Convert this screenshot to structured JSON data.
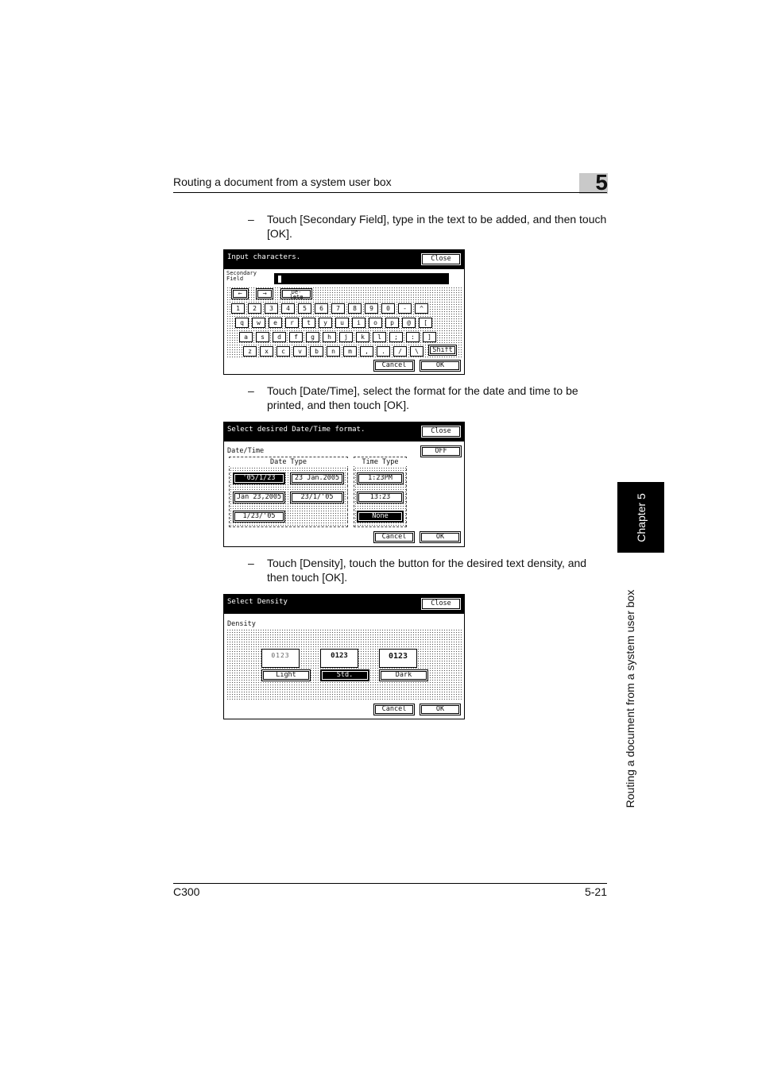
{
  "header": {
    "title": "Routing a document from a system user box",
    "chapter_number": "5"
  },
  "steps": [
    "Touch [Secondary Field], type in the text to be added, and then touch [OK].",
    "Touch [Date/Time], select the format for the date and time to be printed, and then touch [OK].",
    "Touch [Density], touch the button for the desired text density, and then touch [OK]."
  ],
  "dash": "–",
  "screen1": {
    "title": "Input characters.",
    "close": "Close",
    "field_label_1": "Secondary",
    "field_label_2": "Field",
    "left_arrow": "←",
    "right_arrow": "→",
    "delete_1": "De-",
    "delete_2": "lete",
    "row1": [
      "1",
      "2",
      "3",
      "4",
      "5",
      "6",
      "7",
      "8",
      "9",
      "0",
      "-",
      "^"
    ],
    "row2": [
      "q",
      "w",
      "e",
      "r",
      "t",
      "y",
      "u",
      "i",
      "o",
      "p",
      "@",
      "["
    ],
    "row3": [
      "a",
      "s",
      "d",
      "f",
      "g",
      "h",
      "j",
      "k",
      "l",
      ";",
      ":",
      "]"
    ],
    "row4": [
      "z",
      "x",
      "c",
      "v",
      "b",
      "n",
      "m",
      ",",
      ".",
      "/",
      "\\"
    ],
    "shift": "Shift",
    "cancel": "Cancel",
    "ok": "OK"
  },
  "screen2": {
    "title": "Select desired Date/Time format.",
    "close": "Close",
    "section": "Date/Time",
    "off": "OFF",
    "date_type": "Date Type",
    "time_type": "Time Type",
    "date_options": [
      "'05/1/23",
      "23 Jan.2005",
      "Jan 23,2005",
      "23/1/'05",
      "1/23/'05"
    ],
    "time_options": [
      "1:23PM",
      "13:23",
      "None"
    ],
    "cancel": "Cancel",
    "ok": "OK"
  },
  "screen3": {
    "title": "Select Density",
    "close": "Close",
    "section": "Density",
    "sample": "0123",
    "options": [
      "Light",
      "Std.",
      "Dark"
    ],
    "cancel": "Cancel",
    "ok": "OK"
  },
  "side": {
    "chapter_tab": "Chapter 5",
    "section_title": "Routing a document from a system user box"
  },
  "footer": {
    "model": "C300",
    "page": "5-21"
  }
}
